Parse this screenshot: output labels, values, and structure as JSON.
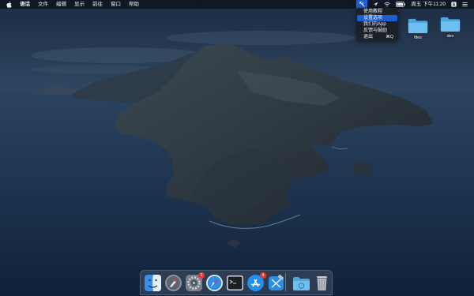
{
  "menubar": {
    "app_name": "语话",
    "items": [
      "文件",
      "编辑",
      "显示",
      "前往",
      "窗口",
      "帮助"
    ],
    "clock": "周五 下午11:20"
  },
  "status_menu": {
    "items": [
      {
        "label": "使用教程",
        "shortcut": ""
      },
      {
        "label": "设置选项",
        "shortcut": ""
      },
      {
        "label": "我们的App",
        "shortcut": ""
      },
      {
        "label": "反馈与鼓励",
        "shortcut": ""
      },
      {
        "label": "退出",
        "shortcut": "⌘Q"
      }
    ],
    "highlighted_index": 1
  },
  "desktop": {
    "icons": [
      {
        "label": "files",
        "icon": "folder-icon"
      },
      {
        "label": "dev",
        "icon": "folder-icon"
      }
    ]
  },
  "dock": {
    "apps": [
      {
        "name": "finder",
        "icon": "finder-icon"
      },
      {
        "name": "launchpad",
        "icon": "launchpad-icon"
      },
      {
        "name": "system-preferences",
        "icon": "gear-icon",
        "badge": "1"
      },
      {
        "name": "safari",
        "icon": "compass-icon"
      },
      {
        "name": "terminal",
        "icon": "terminal-icon"
      },
      {
        "name": "app-store",
        "icon": "app-store-icon",
        "badge": "4"
      },
      {
        "name": "xcode",
        "icon": "hammer-icon"
      },
      {
        "name": "downloads",
        "icon": "folder-icon"
      },
      {
        "name": "trash",
        "icon": "trash-icon"
      }
    ]
  },
  "colors": {
    "menubar": "#0e141e",
    "highlight": "#1d5fd1",
    "badge": "#e23a3a",
    "folder": "#5fb7ec"
  }
}
